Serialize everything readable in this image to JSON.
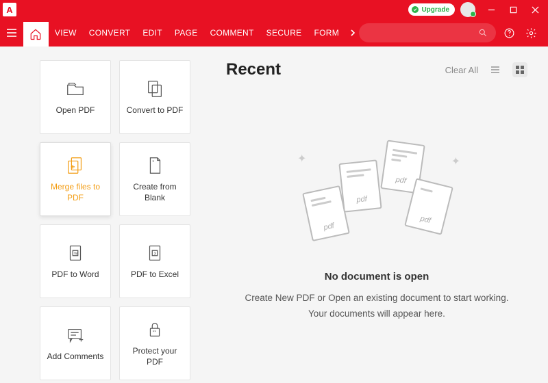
{
  "titlebar": {
    "logo": "A",
    "upgrade": "Upgrade"
  },
  "ribbon": {
    "tabs": [
      "VIEW",
      "CONVERT",
      "EDIT",
      "PAGE",
      "COMMENT",
      "SECURE",
      "FORM"
    ]
  },
  "actions": [
    {
      "label": "Open PDF"
    },
    {
      "label": "Convert to PDF"
    },
    {
      "label": "Merge files to PDF"
    },
    {
      "label": "Create from Blank"
    },
    {
      "label": "PDF to Word"
    },
    {
      "label": "PDF to Excel"
    },
    {
      "label": "Add Comments"
    },
    {
      "label": "Protect your PDF"
    }
  ],
  "recent": {
    "title": "Recent",
    "clear": "Clear All",
    "pdf_label": "pdf",
    "empty_title": "No document is open",
    "empty_line1": "Create New PDF or Open an existing document to start working.",
    "empty_line2": "Your documents will appear here."
  }
}
